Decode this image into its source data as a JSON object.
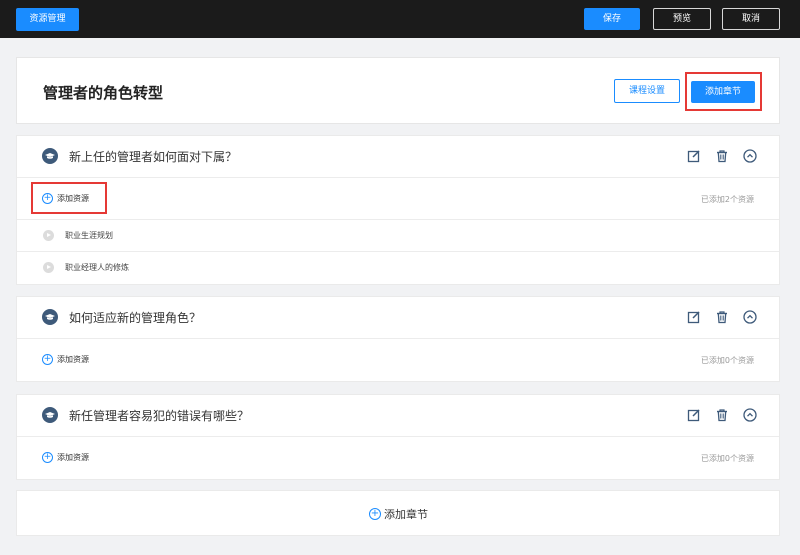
{
  "topbar": {
    "brand_label": "资源管理",
    "save_label": "保存",
    "preview_label": "预览",
    "cancel_label": "取消"
  },
  "course": {
    "title": "管理者的角色转型",
    "settings_label": "课程设置",
    "add_chapter_label": "添加章节"
  },
  "chapters": [
    {
      "title": "新上任的管理者如何面对下属？",
      "add_resource_label": "添加资源",
      "added_count_text": "已添加2个资源",
      "resources": [
        {
          "title": "职业生涯规划"
        },
        {
          "title": "职业经理人的修炼"
        }
      ]
    },
    {
      "title": "如何适应新的管理角色？",
      "add_resource_label": "添加资源",
      "added_count_text": "已添加0个资源",
      "resources": []
    },
    {
      "title": "新任管理者容易犯的错误有哪些？",
      "add_resource_label": "添加资源",
      "added_count_text": "已添加0个资源",
      "resources": []
    }
  ],
  "footer": {
    "add_chapter_label": "添加章节"
  },
  "icons": {
    "chapter_badge": "graduation-cap-icon",
    "edit": "edit-icon",
    "delete": "trash-icon",
    "collapse": "chevron-up-icon",
    "add": "plus-circle-icon",
    "play": "play-icon"
  },
  "colors": {
    "primary": "#1a8cff",
    "topbar": "#1b1b1b",
    "highlight": "#e53935"
  }
}
